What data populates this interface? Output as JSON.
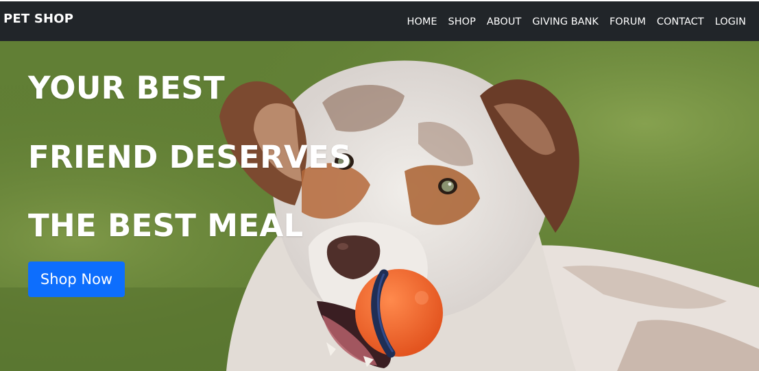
{
  "navbar": {
    "brand": "PET SHOP",
    "links": [
      "HOME",
      "SHOP",
      "ABOUT",
      "GIVING BANK",
      "FORUM",
      "CONTACT",
      "LOGIN"
    ]
  },
  "hero": {
    "headline_lines": [
      "YOUR BEST",
      "FRIEND DESERVES",
      "THE BEST MEAL"
    ],
    "cta_label": "Shop Now"
  },
  "colors": {
    "navbar_bg": "#212529",
    "cta_bg": "#0d6efd",
    "grass": "#5d7c33",
    "ball": "#f26a2e"
  }
}
